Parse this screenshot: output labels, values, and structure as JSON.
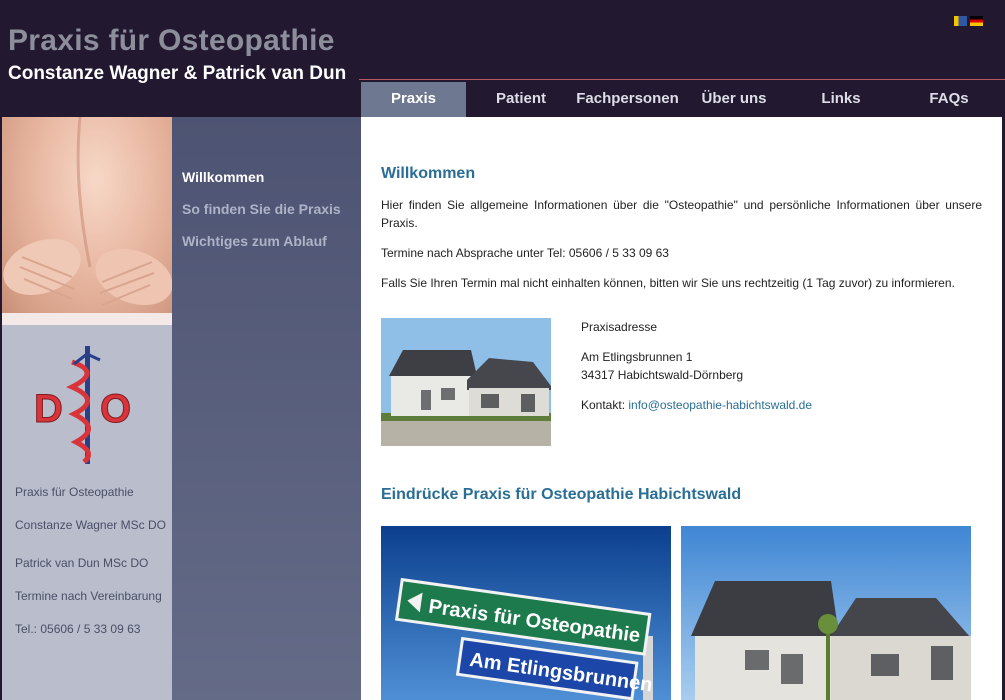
{
  "header": {
    "title": "Praxis für Osteopathie",
    "subtitle": "Constanze Wagner & Patrick van Dun"
  },
  "nav": {
    "items": [
      {
        "label": "Praxis",
        "active": true
      },
      {
        "label": "Patient"
      },
      {
        "label": "Fachpersonen"
      },
      {
        "label": "Über uns"
      },
      {
        "label": "Links"
      },
      {
        "label": "FAQs"
      }
    ]
  },
  "subnav": {
    "items": [
      "Willkommen",
      "So finden Sie die Praxis",
      "Wichtiges zum Ablauf"
    ]
  },
  "logo": {
    "left": "D",
    "right": "O"
  },
  "sidebar_info": {
    "line1": "Praxis für Osteopathie",
    "line2": "Constanze Wagner MSc DO",
    "line3": "Patrick van Dun MSc DO",
    "line4": "Termine nach Vereinbarung",
    "line5": "Tel.: 05606 / 5 33 09 63"
  },
  "content": {
    "heading": "Willkommen",
    "p1": "Hier finden Sie allgemeine Informationen über die \"Osteopathie\" und persönliche Informationen über unsere Praxis.",
    "p2": "Termine nach Absprache unter Tel: 05606 / 5 33 09 63",
    "p3": "Falls Sie Ihren Termin mal nicht einhalten können, bitten wir Sie uns rechtzeitig (1 Tag zuvor) zu informieren.",
    "address": {
      "label": "Praxisadresse",
      "street": "Am Etlingsbrunnen 1",
      "city": "34317 Habichtswald-Dörnberg",
      "contact_label": "Kontakt: ",
      "email": "info@osteopathie-habichtswald.de"
    },
    "heading2": "Eindrücke Praxis für Osteopathie Habichtswald",
    "sign": {
      "line1": "Praxis für Osteopathie",
      "line2": "Am Etlingsbrunnen"
    }
  },
  "colors": {
    "background": "#221830",
    "heading": "#2a6e96",
    "nav_active": "#6f7891"
  }
}
